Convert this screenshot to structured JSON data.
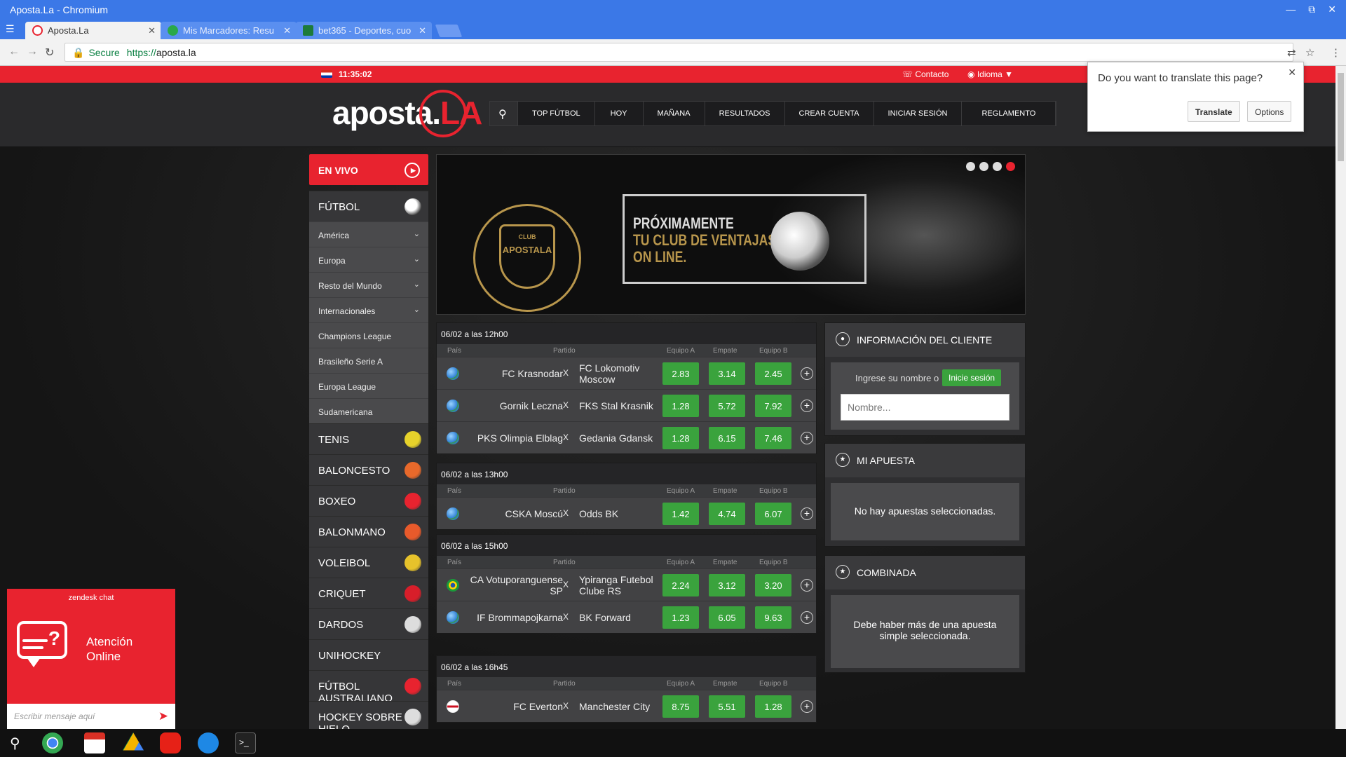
{
  "window": {
    "title": "Aposta.La - Chromium"
  },
  "tabs": [
    {
      "title": "Aposta.La",
      "favicon_color": "#e8232f"
    },
    {
      "title": "Mis Marcadores: Resu",
      "favicon_color": "#2aa84a"
    },
    {
      "title": "bet365 - Deportes, cuo",
      "favicon_color": "#1d7b3a"
    }
  ],
  "omnibox": {
    "secure_label": "Secure",
    "scheme": "https://",
    "host": "aposta.la"
  },
  "topbar": {
    "time": "11:35:02",
    "contact": "Contacto",
    "language": "Idioma"
  },
  "logo": {
    "text": "aposta.",
    "accent": "LA"
  },
  "mainnav": [
    "TOP FÚTBOL",
    "HOY",
    "MAÑANA",
    "RESULTADOS",
    "CREAR CUENTA",
    "INICIAR SESIÓN",
    "REGLAMENTO"
  ],
  "sidebar": {
    "live": "EN VIVO",
    "futbol": "FÚTBOL",
    "futbol_subs": [
      {
        "label": "América",
        "expandable": true
      },
      {
        "label": "Europa",
        "expandable": true
      },
      {
        "label": "Resto del Mundo",
        "expandable": true
      },
      {
        "label": "Internacionales",
        "expandable": true
      },
      {
        "label": "Champions League",
        "expandable": false
      },
      {
        "label": "Brasileño Serie A",
        "expandable": false
      },
      {
        "label": "Europa League",
        "expandable": false
      },
      {
        "label": "Sudamericana",
        "expandable": false
      }
    ],
    "sports": [
      {
        "label": "TENIS",
        "icon": "tennis-ball-icon",
        "color": "#e6d22b"
      },
      {
        "label": "BALONCESTO",
        "icon": "basketball-icon",
        "color": "#e8692b"
      },
      {
        "label": "BOXEO",
        "icon": "boxing-glove-icon",
        "color": "#e8232f"
      },
      {
        "label": "BALONMANO",
        "icon": "handball-icon",
        "color": "#e85a2b"
      },
      {
        "label": "VOLEIBOL",
        "icon": "volleyball-icon",
        "color": "#e6c22b"
      },
      {
        "label": "CRIQUET",
        "icon": "cricket-ball-icon",
        "color": "#d81e2a"
      },
      {
        "label": "DARDOS",
        "icon": "dartboard-icon",
        "color": "#ddd"
      },
      {
        "label": "UNIHOCKEY",
        "icon": "",
        "color": ""
      },
      {
        "label": "FÚTBOL AUSTRALIANO",
        "icon": "australian-football-icon",
        "color": "#e8232f"
      },
      {
        "label": "HOCKEY SOBRE HIELO",
        "icon": "hockey-icon",
        "color": "#ddd"
      }
    ]
  },
  "banner": {
    "crest_text": "APOSTALA",
    "crest_club": "CLUB",
    "line1": "PRÓXIMAMENTE",
    "line2": "TU CLUB DE VENTAJAS",
    "line3": "ON LINE."
  },
  "headers": {
    "pais": "País",
    "partido": "Partido",
    "equipo_a": "Equipo A",
    "empate": "Empate",
    "equipo_b": "Equipo B"
  },
  "match_groups": [
    {
      "date": "06/02 a las 12h00",
      "matches": [
        {
          "home": "FC Krasnodar",
          "away": "FC Lokomotiv Moscow",
          "a": "2.83",
          "draw": "3.14",
          "b": "2.45",
          "flag": "world"
        },
        {
          "home": "Gornik Leczna",
          "away": "FKS Stal Krasnik",
          "a": "1.28",
          "draw": "5.72",
          "b": "7.92",
          "flag": "world"
        },
        {
          "home": "PKS Olimpia Elblag",
          "away": "Gedania Gdansk",
          "a": "1.28",
          "draw": "6.15",
          "b": "7.46",
          "flag": "world"
        }
      ]
    },
    {
      "date": "06/02 a las 13h00",
      "matches": [
        {
          "home": "CSKA Moscú",
          "away": "Odds BK",
          "a": "1.42",
          "draw": "4.74",
          "b": "6.07",
          "flag": "world"
        }
      ]
    },
    {
      "date": "06/02 a las 15h00",
      "matches": [
        {
          "home": "CA Votuporanguense SP",
          "away": "Ypiranga Futebol Clube RS",
          "a": "2.24",
          "draw": "3.12",
          "b": "3.20",
          "flag": "brazil"
        },
        {
          "home": "IF Brommapojkarna",
          "away": "BK Forward",
          "a": "1.23",
          "draw": "6.05",
          "b": "9.63",
          "flag": "world"
        }
      ]
    },
    {
      "date": "06/02 a las 16h45",
      "matches": [
        {
          "home": "FC Everton",
          "away": "Manchester City",
          "a": "8.75",
          "draw": "5.51",
          "b": "1.28",
          "flag": "england"
        }
      ]
    }
  ],
  "client_panel": {
    "title": "INFORMACIÓN DEL CLIENTE",
    "prompt": "Ingrese su nombre o",
    "login": "Inicie sesión",
    "placeholder": "Nombre..."
  },
  "bet_panel": {
    "title": "MI APUESTA",
    "empty": "No hay apuestas seleccionadas."
  },
  "combo_panel": {
    "title": "COMBINADA",
    "message": "Debe haber más de una apuesta simple seleccionada."
  },
  "translate": {
    "question": "Do you want to translate this page?",
    "translate": "Translate",
    "options": "Options"
  },
  "chat": {
    "brand": "zendesk chat",
    "label_line1": "Atención",
    "label_line2": "Online",
    "placeholder": "Escribir mensaje aquí"
  },
  "colors": {
    "brand_red": "#e8232f",
    "odds_green": "#3aa33d",
    "chrome_blue": "#3b78e7"
  }
}
